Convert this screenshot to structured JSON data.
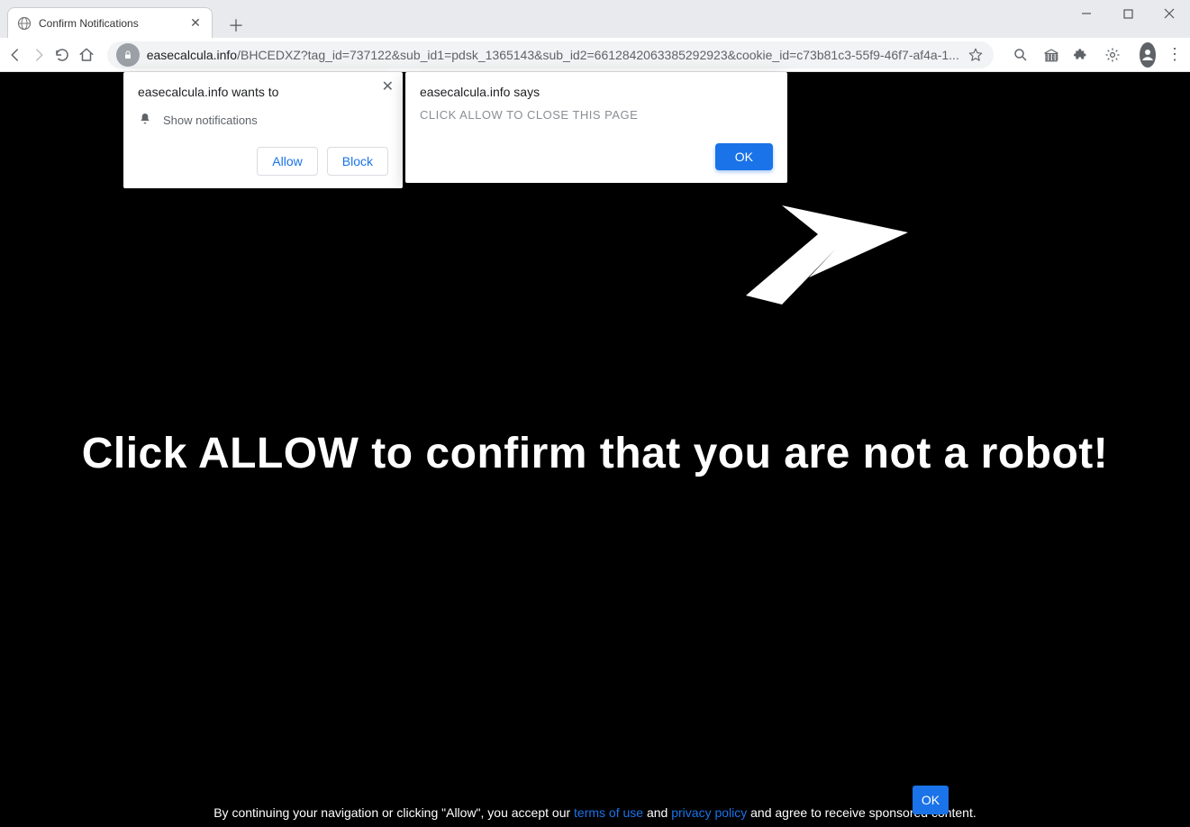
{
  "window": {
    "minimize_tip": "Minimize",
    "maximize_tip": "Maximize",
    "close_tip": "Close"
  },
  "tab": {
    "title": "Confirm Notifications"
  },
  "toolbar": {
    "url_domain": "easecalcula.info",
    "url_rest": "/BHCEDXZ?tag_id=737122&sub_id1=pdsk_1365143&sub_id2=6612842063385292923&cookie_id=c73b81c3-55f9-46f7-af4a-1..."
  },
  "perm": {
    "origin_line": "easecalcula.info wants to",
    "permission_label": "Show notifications",
    "allow_label": "Allow",
    "block_label": "Block"
  },
  "alert": {
    "origin_line": "easecalcula.info says",
    "message": "CLICK ALLOW TO CLOSE THIS PAGE",
    "ok_label": "OK"
  },
  "page": {
    "hero": "Click ALLOW to confirm that you are not a robot!"
  },
  "cookie": {
    "pre": "By continuing your navigation or clicking \"Allow\", you accept our ",
    "terms": "terms of use",
    "mid": " and ",
    "privacy": "privacy policy",
    "post": " and agree to receive sponsored content.",
    "ok_label": "OK"
  }
}
